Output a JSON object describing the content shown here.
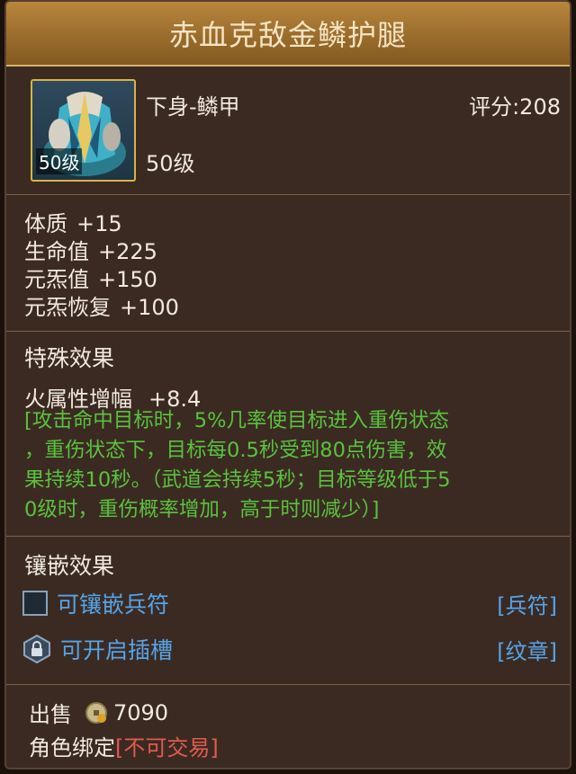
{
  "item": {
    "name": "赤血克敌金鳞护腿",
    "type": "下身-鳞甲",
    "score_label": "评分:208",
    "level": "50级",
    "icon_level_badge": "50级"
  },
  "stats": [
    {
      "name": "体质",
      "value": "+15"
    },
    {
      "name": "生命值",
      "value": "+225"
    },
    {
      "name": "元炁值",
      "value": "+150"
    },
    {
      "name": "元炁恢复",
      "value": "+100"
    }
  ],
  "special": {
    "title": "特殊效果",
    "effect_name": "火属性增幅",
    "effect_value": "+8.4",
    "lines": [
      "[攻击命中目标时，5%几率使目标进入重伤状态",
      "，重伤状态下，目标每0.5秒受到80点伤害，效",
      "果持续10秒。（武道会持续5秒；目标等级低于5",
      "0级时，重伤概率增加，高于时则减少）]"
    ]
  },
  "inlay": {
    "title": "镶嵌效果",
    "slots": [
      {
        "label": "可镶嵌兵符",
        "tag": "[兵符]",
        "icon": "empty-slot-icon"
      },
      {
        "label": "可开启插槽",
        "tag": "[纹章]",
        "icon": "locked-slot-icon"
      }
    ]
  },
  "sell": {
    "label": "出售",
    "price": "7090",
    "icon": "coin-icon"
  },
  "bind": {
    "label": "角色绑定",
    "status": "[不可交易]"
  },
  "colors": {
    "title_bar": "#a4742f",
    "panel": "#3b2a22",
    "effect_text": "#5ac23f",
    "link_blue": "#55a4e8",
    "warning_red": "#e05a4f"
  }
}
